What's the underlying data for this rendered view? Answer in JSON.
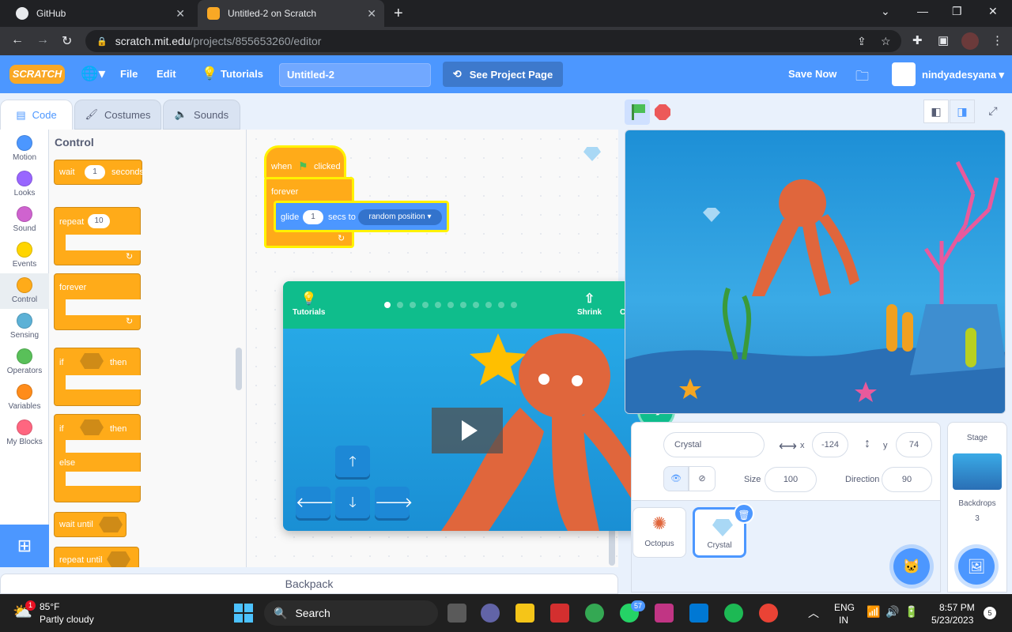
{
  "browser": {
    "tabs": [
      {
        "title": "GitHub",
        "active": false
      },
      {
        "title": "Untitled-2 on Scratch",
        "active": true
      }
    ],
    "url_host": "scratch.mit.edu",
    "url_path": "/projects/855653260/editor"
  },
  "menubar": {
    "logo": "SCRATCH",
    "file": "File",
    "edit": "Edit",
    "tutorials": "Tutorials",
    "project_title": "Untitled-2",
    "see_project": "See Project Page",
    "save_now": "Save Now",
    "username": "nindyadesyana",
    "bg_color": "#4c97ff"
  },
  "editor_tabs": {
    "code": "Code",
    "costumes": "Costumes",
    "sounds": "Sounds"
  },
  "categories": [
    {
      "label": "Motion",
      "color": "#4c97ff"
    },
    {
      "label": "Looks",
      "color": "#9966ff"
    },
    {
      "label": "Sound",
      "color": "#cf63cf"
    },
    {
      "label": "Events",
      "color": "#ffd500"
    },
    {
      "label": "Control",
      "color": "#ffab19"
    },
    {
      "label": "Sensing",
      "color": "#5cb1d6"
    },
    {
      "label": "Operators",
      "color": "#59c059"
    },
    {
      "label": "Variables",
      "color": "#ff8c1a"
    },
    {
      "label": "My Blocks",
      "color": "#ff6680"
    }
  ],
  "palette": {
    "title": "Control",
    "wait": "wait",
    "wait_value": "1",
    "seconds": "seconds",
    "repeat": "repeat",
    "repeat_value": "10",
    "forever": "forever",
    "if": "if",
    "then": "then",
    "else": "else",
    "wait_until": "wait until",
    "repeat_until": "repeat until"
  },
  "script": {
    "when": "when",
    "clicked": "clicked",
    "forever": "forever",
    "glide": "glide",
    "glide_value": "1",
    "secs_to": "secs to",
    "target": "random position"
  },
  "tutorial": {
    "tutorials": "Tutorials",
    "shrink": "Shrink",
    "close": "Close",
    "steps": 11,
    "current_step": 1
  },
  "sprite_info": {
    "name": "Crystal",
    "x_label": "x",
    "x": "-124",
    "y_label": "y",
    "y": "74",
    "size_label": "Size",
    "size": "100",
    "direction_label": "Direction",
    "direction": "90"
  },
  "sprites": [
    {
      "name": "Octopus",
      "selected": false
    },
    {
      "name": "Crystal",
      "selected": true
    }
  ],
  "stage_pane": {
    "title": "Stage",
    "backdrops_label": "Backdrops",
    "backdrops_count": "3"
  },
  "backpack": "Backpack",
  "taskbar": {
    "temp": "85°F",
    "weather": "Partly cloudy",
    "weather_badge": "1",
    "search": "Search",
    "whatsapp_badge": "57",
    "lang1": "ENG",
    "lang2": "IN",
    "time": "8:57 PM",
    "date": "5/23/2023",
    "notif": "5"
  }
}
